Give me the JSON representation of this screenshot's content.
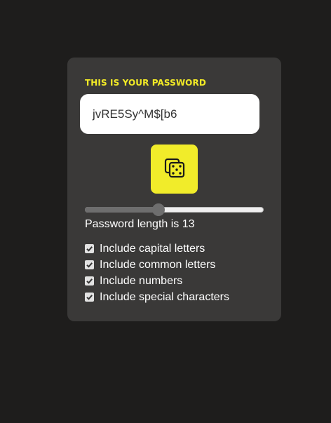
{
  "card": {
    "heading": "THIS IS YOUR PASSWORD",
    "password": "jvRE5Sy^M$[b6",
    "generate_icon": "dice-icon",
    "length_label": "Password length is 13",
    "length_slider": {
      "min": 0,
      "max": 32,
      "value": 13
    },
    "options": [
      {
        "label": "Include capital letters",
        "checked": true
      },
      {
        "label": "Include common letters",
        "checked": true
      },
      {
        "label": "Include numbers",
        "checked": true
      },
      {
        "label": "Include special characters",
        "checked": true
      }
    ]
  },
  "colors": {
    "page_bg": "#1e1d1c",
    "card_bg": "#3a3938",
    "accent": "#f2ea26"
  }
}
